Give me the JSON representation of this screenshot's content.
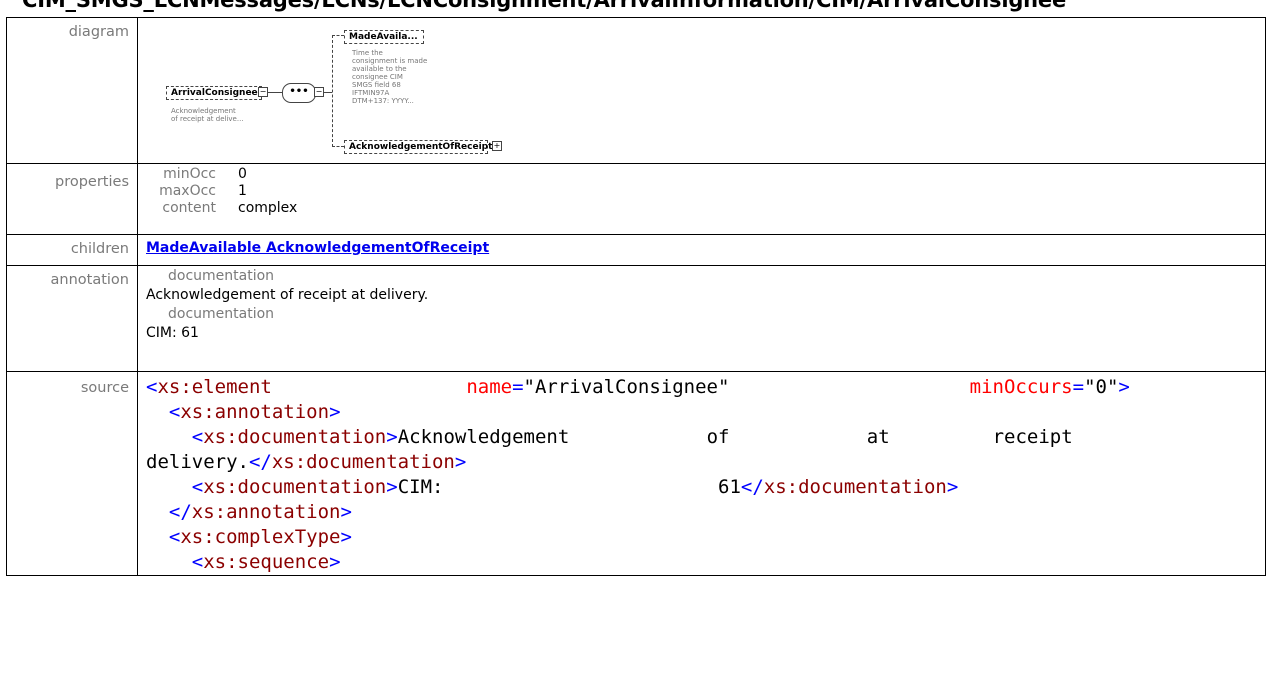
{
  "page": {
    "title": "CIM_SMGS_LCNMessages/LCNs/LCNConsignment/ArrivalInformation/CIM/ArrivalConsignee"
  },
  "labels": {
    "diagram": "diagram",
    "properties": "properties",
    "children": "children",
    "annotation": "annotation",
    "source": "source"
  },
  "diagram": {
    "root": {
      "name": "ArrivalConsignee",
      "doc": [
        "Acknowledgement",
        "of receipt at delive..."
      ]
    },
    "sequence_symbol": "•••",
    "children": [
      {
        "name": "MadeAvaila...",
        "doc": [
          "Time the",
          "consignment is made",
          "available to the",
          "consignee CIM",
          "SMGS field 68",
          "IFTMIN97A",
          "DTM+137: YYYY..."
        ]
      },
      {
        "name": "AcknowledgementOfReceipt"
      }
    ]
  },
  "properties": [
    {
      "key": "minOcc",
      "value": "0"
    },
    {
      "key": "maxOcc",
      "value": "1"
    },
    {
      "key": "content",
      "value": "complex"
    }
  ],
  "children_link": "MadeAvailable AcknowledgementOfReceipt",
  "annotation": [
    {
      "key": "documentation",
      "value": "Acknowledgement of receipt at delivery."
    },
    {
      "key": "documentation",
      "value": "CIM: 61"
    }
  ],
  "source": {
    "line1": {
      "open": "<",
      "tag": "xs:element",
      "attr1": "name",
      "eq": "=",
      "val1": "\"ArrivalConsignee\"",
      "attr2": "minOccurs",
      "val2": "\"0\"",
      "close": ">"
    },
    "line2": {
      "tag": "xs:annotation"
    },
    "line3": {
      "tag": "xs:documentation",
      "text": "Acknowledgement",
      "w2": "of",
      "w3": "receipt",
      "w4": "at"
    },
    "line4": {
      "text": "delivery.",
      "endtag": "xs:documentation"
    },
    "line5": {
      "tag": "xs:documentation",
      "text": "CIM:",
      "text2": "61",
      "endtag": "xs:documentation"
    },
    "line6": {
      "endtag": "xs:annotation"
    },
    "line7": {
      "tag": "xs:complexType"
    },
    "line8": {
      "tag": "xs:sequence"
    }
  }
}
